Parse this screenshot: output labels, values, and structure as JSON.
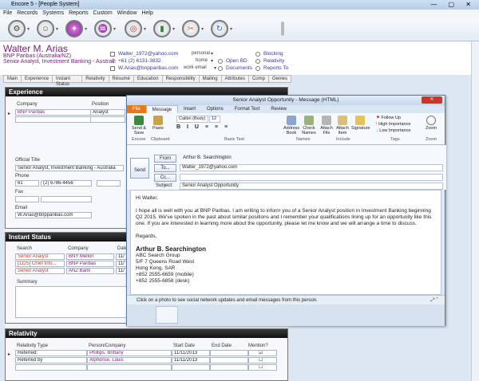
{
  "window": {
    "title": "Encore 5 - [People System]"
  },
  "menu": [
    "File",
    "Records",
    "Systems",
    "Reports",
    "Custom",
    "Window",
    "Help"
  ],
  "person": {
    "name": "Walter M. Arias",
    "company_line": "BNP Paribas (Australia/NZ)",
    "title_line": "Senior Analyst, Investment Banking - Australi",
    "email_personal": "Walter_1972@yahoo.com",
    "phone_home": "+61 (2) 6131-3832",
    "email_work": "W.Arias@bnpparibas.com",
    "lbl_personal": "personal",
    "lbl_home": "home",
    "lbl_work_email": "work email",
    "links": [
      "Blocking",
      "Relativity",
      "Reports To"
    ],
    "radio_open_bd": "Open BD",
    "radio_documents": "Documents"
  },
  "tabs": [
    "Main",
    "Experience",
    "Instant Status",
    "Relativity",
    "Résumé",
    "Education",
    "Responsibility",
    "Mailing",
    "Attributes",
    "Comp",
    "Genies"
  ],
  "experience": {
    "header": "Experience",
    "col_company": "Company",
    "col_position": "Position",
    "company": "BNP Paribas",
    "position": "Analyst",
    "official_title_lbl": "Official Title",
    "official_title": "Senior Analyst, Investment Banking - Australia",
    "phone_lbl": "Phone",
    "phone_cc": "61",
    "phone_num": "(2) 6786-4456",
    "fax_lbl": "Fax",
    "email_lbl": "Email",
    "email": "W.Arias@bnpparibas.com"
  },
  "instant_status": {
    "header": "Instant Status",
    "col_search": "Search",
    "col_company": "Company",
    "col_date": "Date",
    "rows": [
      {
        "search": "Senior Analyst",
        "company": "BNY Mellon",
        "date": "11/"
      },
      {
        "search": "[1125] Chief Info...",
        "company": "BNP Paribas",
        "date": "11/"
      },
      {
        "search": "Senior Analyst",
        "company": "ANZ Bank",
        "date": "11/"
      }
    ],
    "summary_lbl": "Summary"
  },
  "relativity": {
    "header": "Relativity",
    "cols": [
      "Relativity Type",
      "Person/Company",
      "Start Date",
      "End Date",
      "Mention?"
    ],
    "rows": [
      {
        "type": "Referred:",
        "person": "Phillips, Brittany",
        "start": "11/11/2013",
        "end": ""
      },
      {
        "type": "Referred by",
        "person": "Alphonse, Louis",
        "start": "11/11/2013",
        "end": ""
      }
    ]
  },
  "outlook": {
    "title": "Senior Analyst Opportunity - Message (HTML)",
    "tabs": [
      "File",
      "Message",
      "Insert",
      "Options",
      "Format Text",
      "Review"
    ],
    "ribbon": {
      "send_save": "Send & Save",
      "paste": "Paste",
      "font": "Calibri (Body)",
      "size": "12",
      "address_book": "Address Book",
      "check_names": "Check Names",
      "attach_file": "Attach File",
      "attach_item": "Attach Item",
      "signature": "Signature",
      "follow_up": "Follow Up",
      "high_importance": "High Importance",
      "low_importance": "Low Importance",
      "zoom": "Zoom",
      "groups": [
        "Encore",
        "Clipboard",
        "Basic Text",
        "Names",
        "Include",
        "Tags",
        "Zoom"
      ]
    },
    "from_lbl": "From",
    "from_val": "Arthur B. Searchington",
    "to_lbl": "To...",
    "to_val": "Walter_1972@yahoo.com",
    "cc_lbl": "Cc...",
    "subject_lbl": "Subject:",
    "subject_val": "Senior Analyst Opportunity",
    "send_lbl": "Send",
    "greeting": "Hi Walter,",
    "body1": "I hope all is well with you at BNP Paribas. I am writing to inform you of a Senior Analyst position in Investment Banking beginning Q2 2015. We've spoken in the past about similar positions and I remember your qualifications lining up for an opportunity like this one. If you are interested in learning more about the opportunity, please let me know and we will arrange a time to discuss.",
    "regards": "Regards,",
    "sig_name": "Arthur B. Searchington",
    "sig_lines": [
      "ABC Search Group",
      "5/F 7 Queens Road West",
      "Hong Kong, SAR",
      "+852 2555-6659 (mobile)",
      "+852 2555-6858 (desk)"
    ],
    "people_pane": "Click on a photo to see social network updates and email messages from this person."
  }
}
